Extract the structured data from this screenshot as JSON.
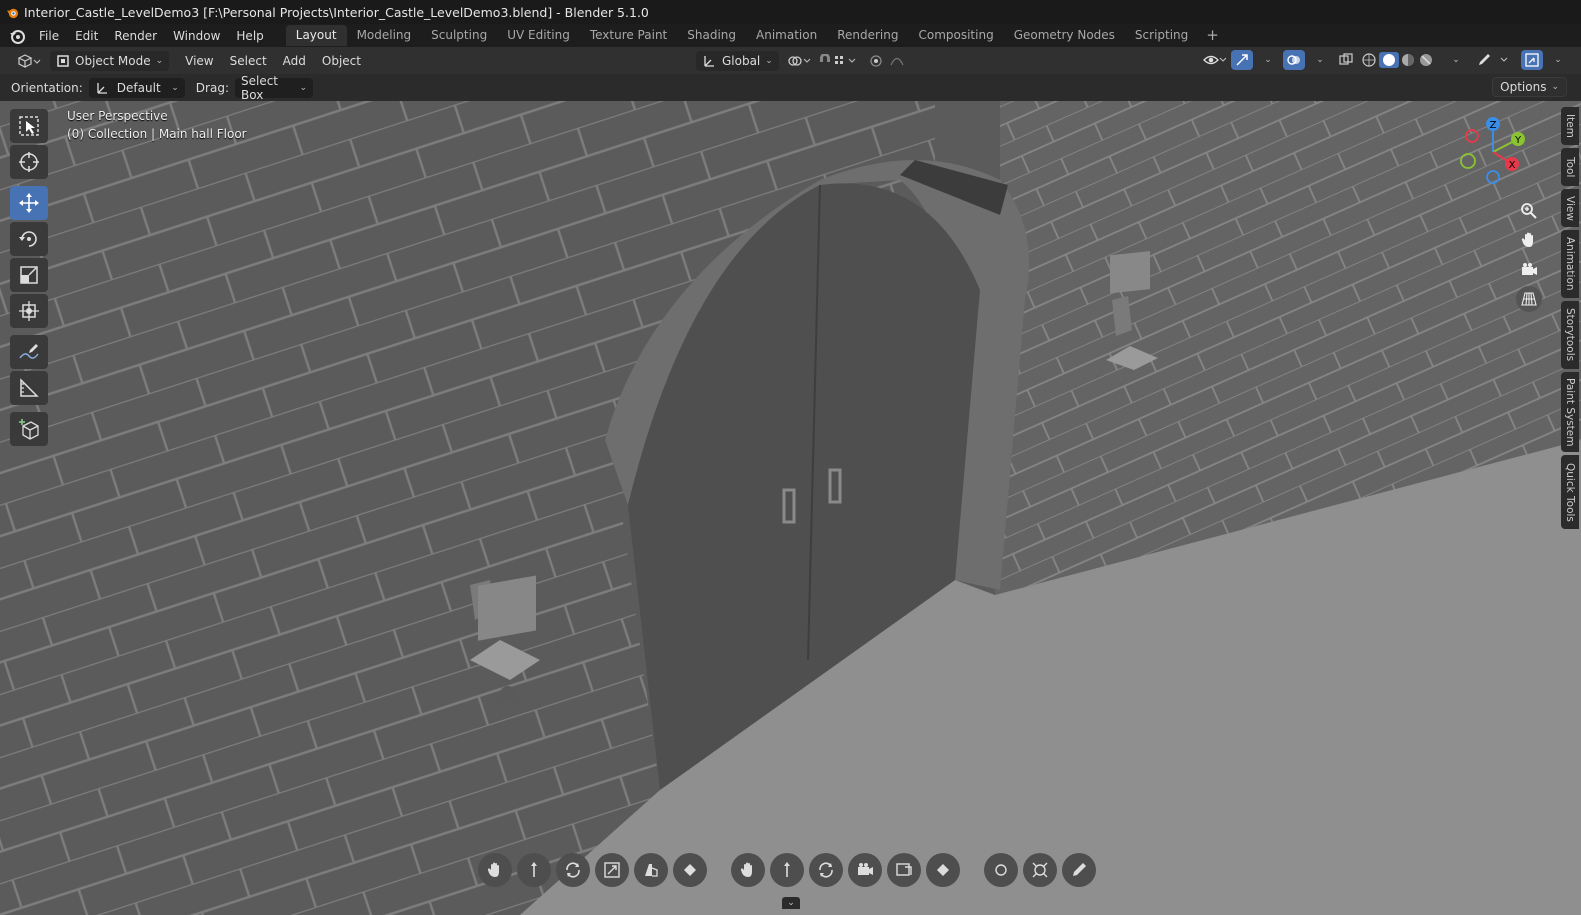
{
  "window": {
    "title": "Interior_Castle_LevelDemo3 [F:\\Personal Projects\\Interior_Castle_LevelDemo3.blend] - Blender 5.1.0"
  },
  "menu": {
    "items": [
      "File",
      "Edit",
      "Render",
      "Window",
      "Help"
    ]
  },
  "workspaces": {
    "tabs": [
      "Layout",
      "Modeling",
      "Sculpting",
      "UV Editing",
      "Texture Paint",
      "Shading",
      "Animation",
      "Rendering",
      "Compositing",
      "Geometry Nodes",
      "Scripting"
    ],
    "active": "Layout",
    "add_label": "+"
  },
  "viewport_header": {
    "mode": "Object Mode",
    "menus": [
      "View",
      "Select",
      "Add",
      "Object"
    ],
    "transform_orientation": "Global"
  },
  "tool_settings": {
    "orientation_label": "Orientation:",
    "orientation_value": "Default",
    "drag_label": "Drag:",
    "drag_value": "Select Box",
    "options_label": "Options"
  },
  "viewport": {
    "perspective": "User Perspective",
    "collection": "(0) Collection | Main hall Floor",
    "gizmo_axes": [
      "Z",
      "Y",
      "X"
    ],
    "axis_colors": {
      "x": "#e8394a",
      "y": "#8ac531",
      "z": "#3a8ee8"
    }
  },
  "sidebar_tabs": [
    "Item",
    "Tool",
    "View",
    "Animation",
    "Storytools",
    "Paint System",
    "Quick Tools"
  ],
  "colors": {
    "accent": "#4772b3",
    "header": "#303030",
    "background": "#1d1d1d"
  }
}
